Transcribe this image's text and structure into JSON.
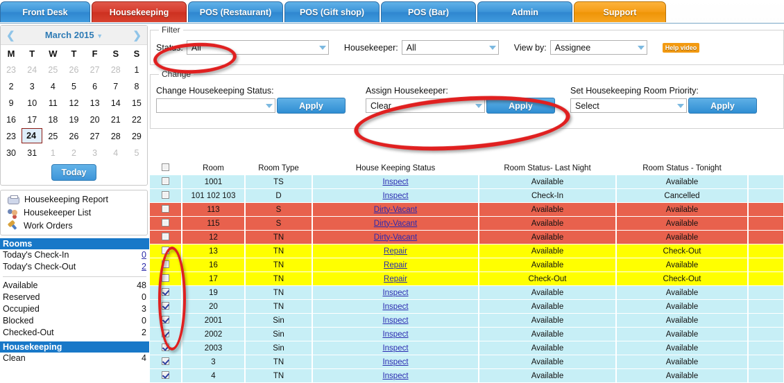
{
  "tabs": [
    {
      "label": "Front Desk",
      "style": "blue"
    },
    {
      "label": "Housekeeping",
      "style": "red"
    },
    {
      "label": "POS (Restaurant)",
      "style": "blue"
    },
    {
      "label": "POS (Gift shop)",
      "style": "blue"
    },
    {
      "label": "POS (Bar)",
      "style": "blue"
    },
    {
      "label": "Admin",
      "style": "blue"
    },
    {
      "label": "Support",
      "style": "orange"
    }
  ],
  "calendar": {
    "prev_arrow": "❮",
    "next_arrow": "❯",
    "month_label": "March 2015",
    "caret": "▼",
    "day_headers": [
      "M",
      "T",
      "W",
      "T",
      "F",
      "S",
      "S"
    ],
    "weeks": [
      [
        {
          "d": "23",
          "muted": true
        },
        {
          "d": "24",
          "muted": true
        },
        {
          "d": "25",
          "muted": true
        },
        {
          "d": "26",
          "muted": true
        },
        {
          "d": "27",
          "muted": true
        },
        {
          "d": "28",
          "muted": true
        },
        {
          "d": "1",
          "muted": false
        }
      ],
      [
        {
          "d": "2"
        },
        {
          "d": "3"
        },
        {
          "d": "4"
        },
        {
          "d": "5"
        },
        {
          "d": "6"
        },
        {
          "d": "7"
        },
        {
          "d": "8"
        }
      ],
      [
        {
          "d": "9"
        },
        {
          "d": "10"
        },
        {
          "d": "11"
        },
        {
          "d": "12"
        },
        {
          "d": "13"
        },
        {
          "d": "14"
        },
        {
          "d": "15"
        }
      ],
      [
        {
          "d": "16"
        },
        {
          "d": "17"
        },
        {
          "d": "18"
        },
        {
          "d": "19"
        },
        {
          "d": "20"
        },
        {
          "d": "21"
        },
        {
          "d": "22"
        }
      ],
      [
        {
          "d": "23"
        },
        {
          "d": "24",
          "selected": true
        },
        {
          "d": "25"
        },
        {
          "d": "26"
        },
        {
          "d": "27"
        },
        {
          "d": "28"
        },
        {
          "d": "29"
        }
      ],
      [
        {
          "d": "30"
        },
        {
          "d": "31"
        },
        {
          "d": "1",
          "muted": true
        },
        {
          "d": "2",
          "muted": true
        },
        {
          "d": "3",
          "muted": true
        },
        {
          "d": "4",
          "muted": true
        },
        {
          "d": "5",
          "muted": true
        }
      ]
    ],
    "today_button": "Today"
  },
  "sidebar_links": [
    {
      "label": "Housekeeping Report",
      "icon": "printer-icon"
    },
    {
      "label": "Housekeeper List",
      "icon": "people-icon"
    },
    {
      "label": "Work Orders",
      "icon": "wrench-icon"
    }
  ],
  "rooms_panel": {
    "header": "Rooms",
    "today_rows": [
      {
        "label": "Today's Check-In",
        "value": "0",
        "link": true
      },
      {
        "label": "Today's Check-Out",
        "value": "2",
        "link": true
      }
    ],
    "status_rows": [
      {
        "label": "Available",
        "value": "48"
      },
      {
        "label": "Reserved",
        "value": "0"
      },
      {
        "label": "Occupied",
        "value": "3"
      },
      {
        "label": "Blocked",
        "value": "0"
      },
      {
        "label": "Checked-Out",
        "value": "2"
      }
    ]
  },
  "housekeeping_panel": {
    "header": "Housekeeping",
    "rows": [
      {
        "label": "Clean",
        "value": "4"
      }
    ]
  },
  "filter": {
    "legend": "Filter",
    "status_label": "Status:",
    "status_value": "All",
    "housekeeper_label": "Housekeeper:",
    "housekeeper_value": "All",
    "viewby_label": "View by:",
    "viewby_value": "Assignee",
    "help_video": "Help video"
  },
  "change": {
    "legend": "Change",
    "status_label": "Change Housekeeping Status:",
    "status_value": "",
    "status_apply": "Apply",
    "assign_label": "Assign Housekeeper:",
    "assign_value": "Clear",
    "assign_apply": "Apply",
    "priority_label": "Set Housekeeping Room Priority:",
    "priority_value": "Select",
    "priority_apply": "Apply"
  },
  "table": {
    "headers": [
      "",
      "Room",
      "Room Type",
      "House Keeping Status",
      "Room Status- Last Night",
      "Room Status - Tonight",
      ""
    ],
    "rows": [
      {
        "checked": false,
        "room": "1001",
        "type": "TS",
        "hk": "Inspect",
        "last": "Available",
        "tonight": "Available",
        "color": "cyan"
      },
      {
        "checked": false,
        "room": "101 102 103",
        "type": "D",
        "hk": "Inspect",
        "last": "Check-In",
        "tonight": "Cancelled",
        "color": "cyan"
      },
      {
        "checked": false,
        "room": "113",
        "type": "S",
        "hk": "Dirty-Vacant",
        "last": "Available",
        "tonight": "Available",
        "color": "red"
      },
      {
        "checked": false,
        "room": "115",
        "type": "S",
        "hk": "Dirty-Vacant",
        "last": "Available",
        "tonight": "Available",
        "color": "red"
      },
      {
        "checked": false,
        "room": "12",
        "type": "TN",
        "hk": "Dirty-Vacant",
        "last": "Available",
        "tonight": "Available",
        "color": "red"
      },
      {
        "checked": false,
        "room": "13",
        "type": "TN",
        "hk": "Repair",
        "last": "Available",
        "tonight": "Check-Out",
        "color": "yellow"
      },
      {
        "checked": false,
        "room": "16",
        "type": "TN",
        "hk": "Repair",
        "last": "Available",
        "tonight": "Available",
        "color": "yellow"
      },
      {
        "checked": false,
        "room": "17",
        "type": "TN",
        "hk": "Repair",
        "last": "Check-Out",
        "tonight": "Check-Out",
        "color": "yellow"
      },
      {
        "checked": true,
        "room": "19",
        "type": "TN",
        "hk": "Inspect",
        "last": "Available",
        "tonight": "Available",
        "color": "cyan"
      },
      {
        "checked": true,
        "room": "20",
        "type": "TN",
        "hk": "Inspect",
        "last": "Available",
        "tonight": "Available",
        "color": "cyan"
      },
      {
        "checked": true,
        "room": "2001",
        "type": "Sin",
        "hk": "Inspect",
        "last": "Available",
        "tonight": "Available",
        "color": "cyan"
      },
      {
        "checked": true,
        "room": "2002",
        "type": "Sin",
        "hk": "Inspect",
        "last": "Available",
        "tonight": "Available",
        "color": "cyan"
      },
      {
        "checked": true,
        "room": "2003",
        "type": "Sin",
        "hk": "Inspect",
        "last": "Available",
        "tonight": "Available",
        "color": "cyan"
      },
      {
        "checked": true,
        "room": "3",
        "type": "TN",
        "hk": "Inspect",
        "last": "Available",
        "tonight": "Available",
        "color": "cyan"
      },
      {
        "checked": true,
        "room": "4",
        "type": "TN",
        "hk": "Inspect",
        "last": "Available",
        "tonight": "Available",
        "color": "cyan"
      }
    ]
  },
  "annotations": {
    "color": "#e02020",
    "shapes": [
      "status-filter-oval",
      "assign-housekeeper-oval",
      "checkbox-column-oval"
    ]
  }
}
